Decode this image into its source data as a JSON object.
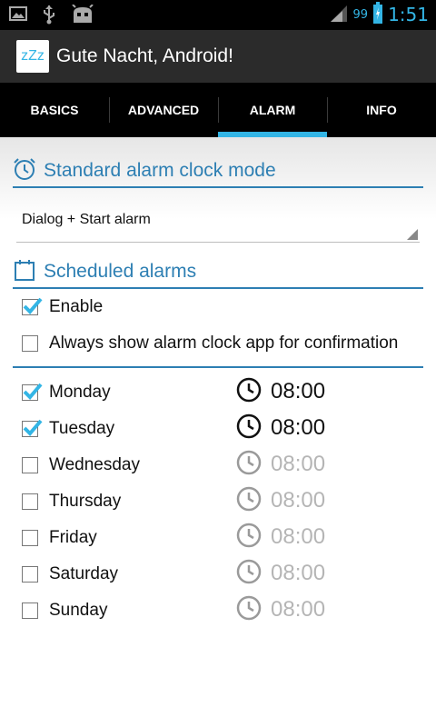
{
  "status_bar": {
    "battery_level": "99",
    "time": "1:51",
    "icons": [
      "image-icon",
      "usb-icon",
      "android-debug-icon",
      "signal-icon",
      "battery-icon"
    ]
  },
  "action_bar": {
    "app_icon_text": "zZz",
    "title": "Gute Nacht, Android!"
  },
  "tabs": [
    {
      "label": "BASICS",
      "active": false
    },
    {
      "label": "ADVANCED",
      "active": false
    },
    {
      "label": "ALARM",
      "active": true
    },
    {
      "label": "INFO",
      "active": false
    }
  ],
  "standard_alarm": {
    "header": "Standard alarm clock mode",
    "header_icon": "alarm-clock-icon",
    "spinner_value": "Dialog + Start alarm"
  },
  "scheduled": {
    "header": "Scheduled alarms",
    "header_icon": "calendar-icon",
    "enable_label": "Enable",
    "enable_checked": true,
    "always_show_label": "Always show alarm clock app for confirmation",
    "always_show_checked": false
  },
  "days": [
    {
      "name": "Monday",
      "checked": true,
      "time": "08:00"
    },
    {
      "name": "Tuesday",
      "checked": true,
      "time": "08:00"
    },
    {
      "name": "Wednesday",
      "checked": false,
      "time": "08:00"
    },
    {
      "name": "Thursday",
      "checked": false,
      "time": "08:00"
    },
    {
      "name": "Friday",
      "checked": false,
      "time": "08:00"
    },
    {
      "name": "Saturday",
      "checked": false,
      "time": "08:00"
    },
    {
      "name": "Sunday",
      "checked": false,
      "time": "08:00"
    }
  ],
  "colors": {
    "accent": "#33b5e5",
    "section_blue": "#2d7fb3",
    "disabled_gray": "#b5b5b5"
  }
}
